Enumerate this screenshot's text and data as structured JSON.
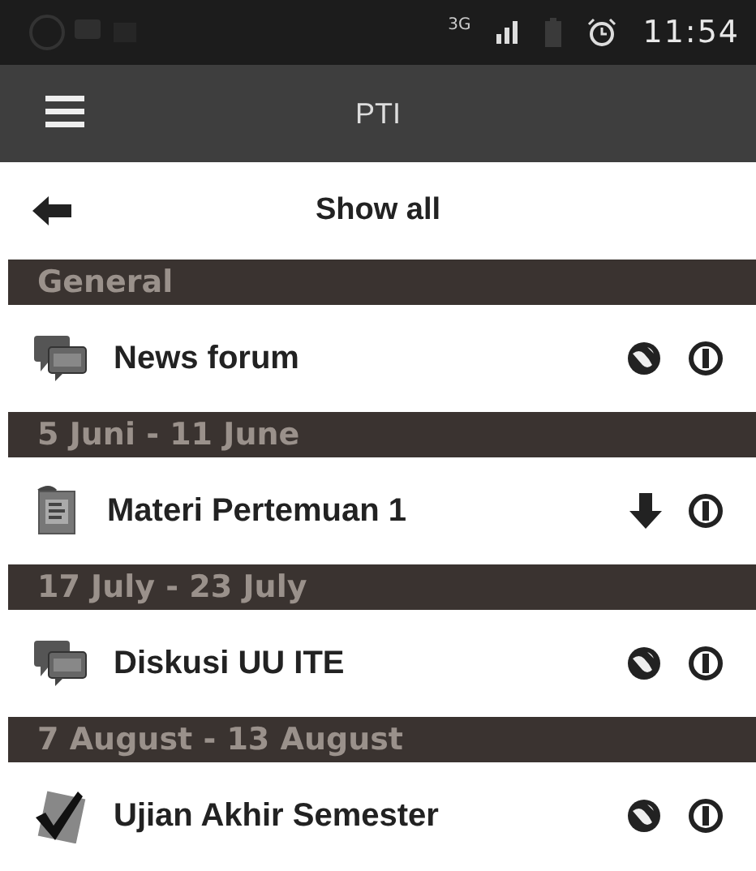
{
  "status_bar": {
    "network": "3G",
    "time": "11:54"
  },
  "app_bar": {
    "title": "PTI"
  },
  "back_row": {
    "label": "Show all"
  },
  "sections": [
    {
      "title": "General",
      "items": [
        {
          "kind": "forum",
          "label": "News forum",
          "action": {
            "kind": "globe"
          }
        }
      ]
    },
    {
      "title": "5 Juni - 11 June",
      "items": [
        {
          "kind": "resource",
          "label": "Materi Pertemuan 1",
          "action": {
            "kind": "download"
          }
        }
      ]
    },
    {
      "title": "17 July - 23 July",
      "items": [
        {
          "kind": "forum",
          "label": "Diskusi UU ITE",
          "action": {
            "kind": "globe"
          }
        }
      ]
    },
    {
      "title": "7 August - 13 August",
      "items": [
        {
          "kind": "quiz",
          "label": "Ujian Akhir Semester",
          "action": {
            "kind": "globe"
          }
        }
      ]
    }
  ]
}
